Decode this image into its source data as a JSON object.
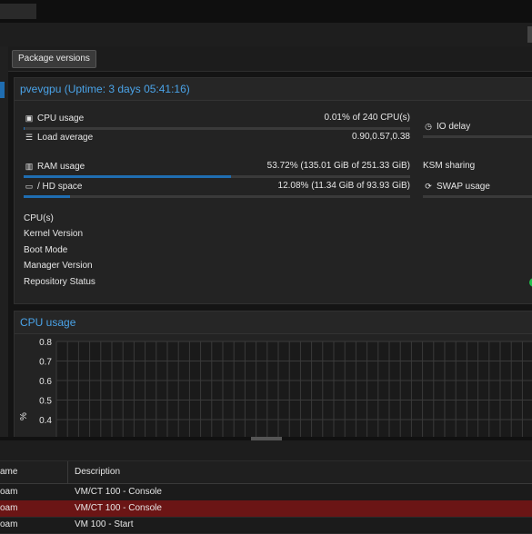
{
  "toolbar": {
    "package_versions_label": "Package versions"
  },
  "summary": {
    "title": "pvevgpu (Uptime: 3 days 05:41:16)",
    "cpu_usage": {
      "label": "CPU usage",
      "value": "0.01% of 240 CPU(s)",
      "fraction": 0.0001
    },
    "load_average": {
      "label": "Load average",
      "value": "0.90,0.57,0.38"
    },
    "io_delay": {
      "label": "IO delay"
    },
    "ram_usage": {
      "label": "RAM usage",
      "value": "53.72% (135.01 GiB of 251.33 GiB)",
      "fraction": 0.5372
    },
    "ksm_sharing": {
      "label": "KSM sharing"
    },
    "hd_space": {
      "label": "/ HD space",
      "value": "12.08% (11.34 GiB of 93.93 GiB)",
      "fraction": 0.1208
    },
    "swap_usage": {
      "label": "SWAP usage"
    },
    "info_labels": [
      "CPU(s)",
      "Kernel Version",
      "Boot Mode",
      "Manager Version",
      "Repository Status"
    ],
    "repo_status_color": "#21bf4b"
  },
  "cpu_chart": {
    "title": "CPU usage",
    "ylabel": "%"
  },
  "chart_data": {
    "type": "line",
    "title": "CPU usage",
    "ylabel": "%",
    "yticks": [
      "0.8",
      "0.7",
      "0.6",
      "0.5",
      "0.4"
    ],
    "ylim": [
      0.4,
      0.8
    ],
    "grid": true,
    "series": []
  },
  "tasks": {
    "columns": [
      "ame",
      "Description"
    ],
    "rows": [
      {
        "name": "oam",
        "description": "VM/CT 100 - Console",
        "selected": false
      },
      {
        "name": "oam",
        "description": "VM/CT 100 - Console",
        "selected": true
      },
      {
        "name": "oam",
        "description": "VM 100 - Start",
        "selected": false
      }
    ]
  },
  "colors": {
    "accent": "#1f6db1",
    "title_blue": "#4aa3e8",
    "selected_row": "#6b1515"
  }
}
